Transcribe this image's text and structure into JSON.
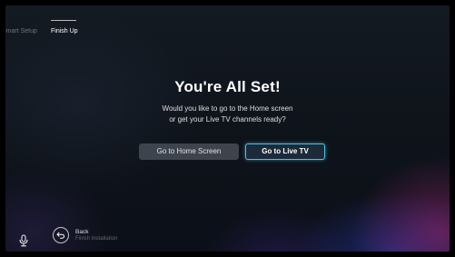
{
  "tabs": {
    "previous": "Smart Setup",
    "current": "Finish Up"
  },
  "main": {
    "title": "You're All Set!",
    "subtitle_line1": "Would you like to go to the Home screen",
    "subtitle_line2": "or get your Live TV channels ready?"
  },
  "buttons": {
    "home": "Go to Home Screen",
    "live_tv": "Go to Live TV"
  },
  "footer": {
    "back_label": "Back",
    "back_sub": "Finish Installation",
    "mic_icon": "microphone-icon",
    "back_icon": "back-arrow-icon"
  },
  "colors": {
    "focus_border": "#4cc3e8"
  }
}
